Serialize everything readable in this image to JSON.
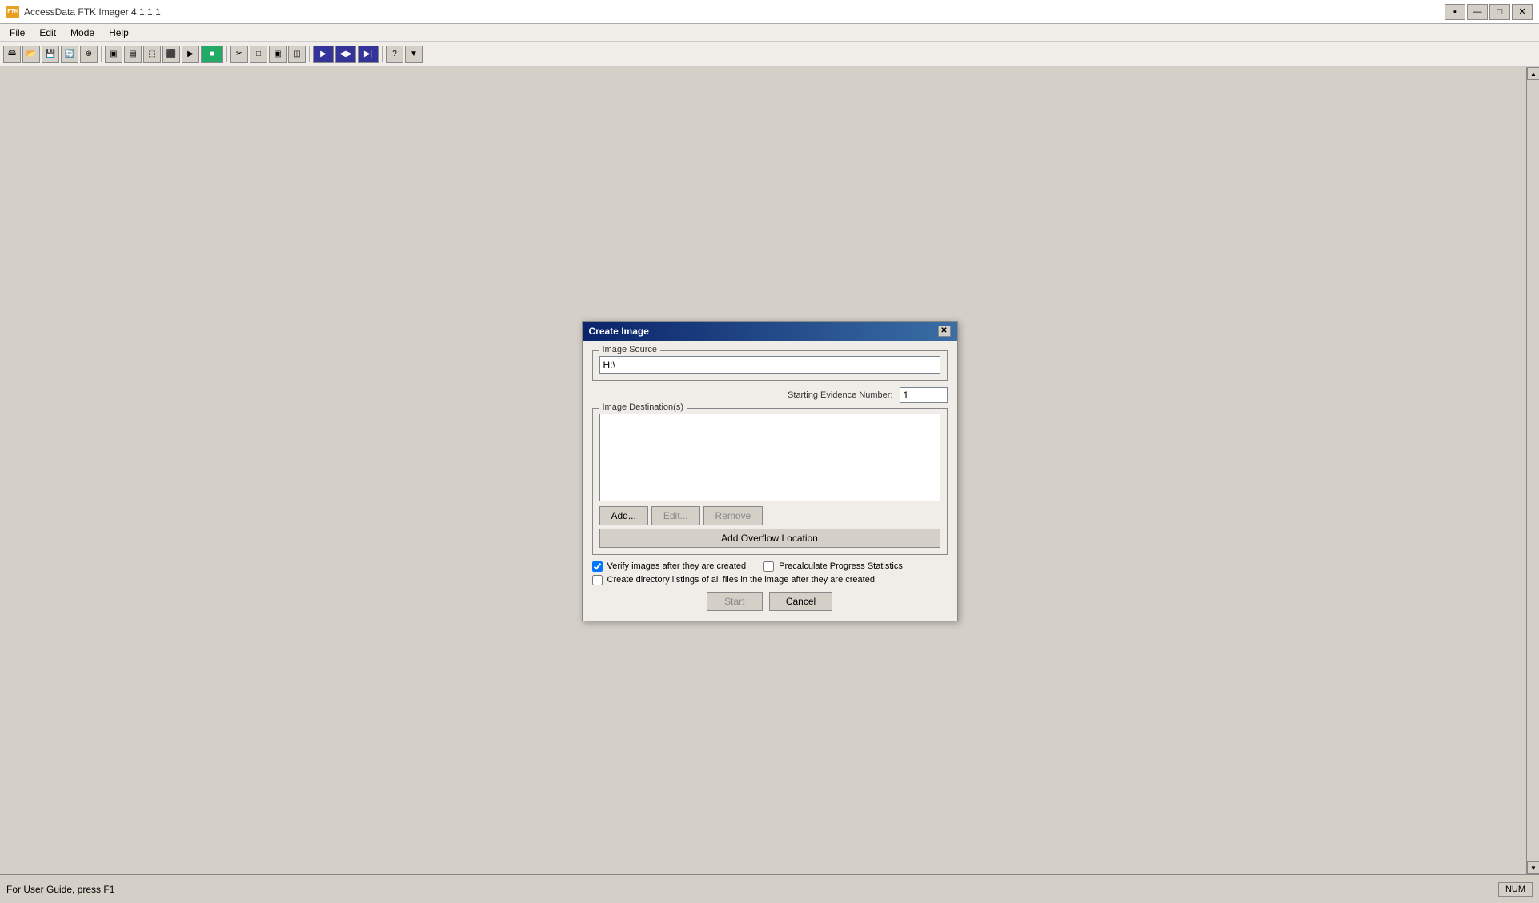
{
  "app": {
    "title": "AccessData FTK Imager 4.1.1.1",
    "icon_label": "FTK"
  },
  "title_buttons": {
    "pin": "▪",
    "minimize": "—",
    "maximize": "□",
    "close": "✕"
  },
  "menu": {
    "items": [
      "File",
      "Edit",
      "Mode",
      "Help"
    ]
  },
  "dialog": {
    "title": "Create Image",
    "image_source_label": "Image Source",
    "image_source_value": "H:\\",
    "evidence_number_label": "Starting Evidence Number:",
    "evidence_number_value": "1",
    "image_destination_label": "Image Destination(s)",
    "add_btn": "Add...",
    "edit_btn": "Edit...",
    "remove_btn": "Remove",
    "overflow_btn": "Add Overflow Location",
    "checkbox1_label": "Verify images after they are created",
    "checkbox1_checked": true,
    "checkbox2_label": "Precalculate Progress Statistics",
    "checkbox2_checked": false,
    "checkbox3_label": "Create directory listings of all files in the image after they are created",
    "checkbox3_checked": false,
    "start_btn": "Start",
    "cancel_btn": "Cancel"
  },
  "status": {
    "text": "For User Guide, press F1",
    "indicator": "NUM"
  }
}
